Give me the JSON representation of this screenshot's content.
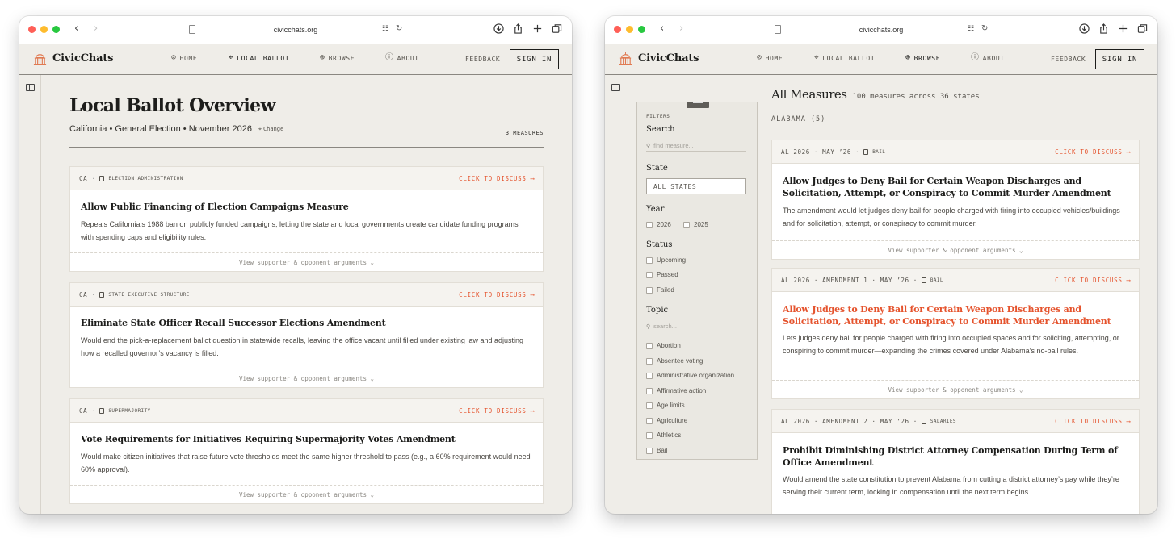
{
  "browser": {
    "url": "civicchats.org"
  },
  "site": {
    "brand": "CivicChats",
    "nav": {
      "home": "HOME",
      "local_ballot": "LOCAL BALLOT",
      "browse": "BROWSE",
      "about": "ABOUT"
    },
    "feedback": "FEEDBACK",
    "sign_in": "SIGN IN"
  },
  "left_window": {
    "active_nav": "LOCAL BALLOT",
    "title": "Local Ballot Overview",
    "subtitle": "California • General Election • November 2026",
    "change_label": "Change",
    "measure_count": "3 MEASURES",
    "cards": [
      {
        "state": "CA",
        "tag": "ELECTION ADMINISTRATION",
        "discuss": "CLICK TO DISCUSS ⟶",
        "title": "Allow Public Financing of Election Campaigns Measure",
        "desc": "Repeals California’s 1988 ban on publicly funded campaigns, letting the state and local governments create candidate funding programs with spending caps and eligibility rules.",
        "footer": "View supporter & opponent arguments ⌄"
      },
      {
        "state": "CA",
        "tag": "STATE EXECUTIVE STRUCTURE",
        "discuss": "CLICK TO DISCUSS ⟶",
        "title": "Eliminate State Officer Recall Successor Elections Amendment",
        "desc": "Would end the pick-a-replacement ballot question in statewide recalls, leaving the office vacant until filled under existing law and adjusting how a recalled governor’s vacancy is filled.",
        "footer": "View supporter & opponent arguments ⌄"
      },
      {
        "state": "CA",
        "tag": "SUPERMAJORITY",
        "discuss": "CLICK TO DISCUSS ⟶",
        "title": "Vote Requirements for Initiatives Requiring Supermajority Votes Amendment",
        "desc": "Would make citizen initiatives that raise future vote thresholds meet the same higher threshold to pass (e.g., a 60% requirement would need 60% approval).",
        "footer": "View supporter & opponent arguments ⌄"
      }
    ]
  },
  "right_window": {
    "active_nav": "BROWSE",
    "filters": {
      "label": "FILTERS",
      "search_heading": "Search",
      "search_placeholder": "find measure...",
      "state_heading": "State",
      "state_value": "ALL STATES",
      "year_heading": "Year",
      "years": [
        "2026",
        "2025"
      ],
      "status_heading": "Status",
      "statuses": [
        "Upcoming",
        "Passed",
        "Failed"
      ],
      "topic_heading": "Topic",
      "topic_placeholder": "search...",
      "topics": [
        "Abortion",
        "Absentee voting",
        "Administrative organization",
        "Affirmative action",
        "Age limits",
        "Agriculture",
        "Athletics",
        "Bail"
      ]
    },
    "title": "All Measures",
    "summary": "100 measures across 36 states",
    "state_group": "ALABAMA (5)",
    "cards": [
      {
        "meta": "AL 2026 · MAY ’26 ·",
        "tag": "BAIL",
        "discuss": "CLICK TO DISCUSS ⟶",
        "title": "Allow Judges to Deny Bail for Certain Weapon Discharges and Solicitation, Attempt, or Conspiracy to Commit Murder Amendment",
        "desc": "The amendment would let judges deny bail for people charged with firing into occupied vehicles/buildings and for solicitation, attempt, or conspiracy to commit murder.",
        "footer": "View supporter & opponent arguments ⌄"
      },
      {
        "meta": "AL 2026 · AMENDMENT 1 · MAY ’26 ·",
        "tag": "BAIL",
        "discuss": "CLICK TO DISCUSS ⟶",
        "title": "Allow Judges to Deny Bail for Certain Weapon Discharges and Solicitation, Attempt, or Conspiracy to Commit Murder Amendment",
        "desc": "Lets judges deny bail for people charged with firing into occupied spaces and for soliciting, attempting, or conspiring to commit murder—expanding the crimes covered under Alabama’s no-bail rules.",
        "footer": "View supporter & opponent arguments ⌄"
      },
      {
        "meta": "AL 2026 · AMENDMENT 2 · MAY ’26 ·",
        "tag": "SALARIES",
        "discuss": "CLICK TO DISCUSS ⟶",
        "title": "Prohibit Diminishing District Attorney Compensation During Term of Office Amendment",
        "desc": "Would amend the state constitution to prevent Alabama from cutting a district attorney’s pay while they’re serving their current term, locking in compensation until the next term begins."
      }
    ]
  },
  "colors": {
    "accent": "#e5532d",
    "page_bg": "#efede8",
    "card_bg": "#ffffff"
  }
}
